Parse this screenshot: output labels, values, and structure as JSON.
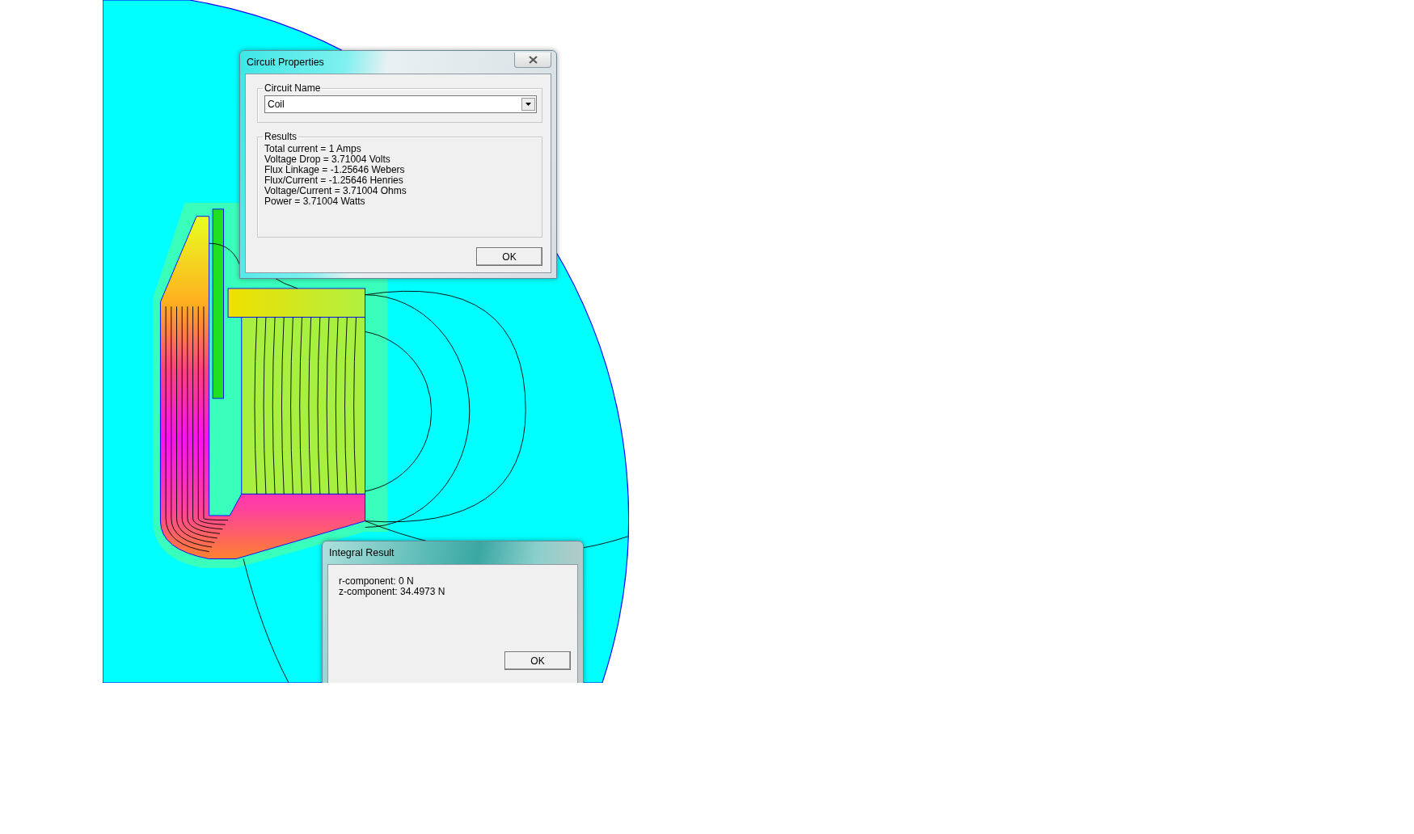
{
  "circuit_dialog": {
    "title": "Circuit Properties",
    "name_group": "Circuit Name",
    "circuit_name": "Coil",
    "results_group": "Results",
    "results": [
      "Total current = 1 Amps",
      "Voltage Drop = 3.71004 Volts",
      "Flux Linkage = -1.25646 Webers",
      "Flux/Current = -1.25646 Henries",
      "Voltage/Current = 3.71004 Ohms",
      "Power = 3.71004 Watts"
    ],
    "ok": "OK"
  },
  "integral_dialog": {
    "title": "Integral Result",
    "lines": [
      "r-component: 0 N",
      "z-component: 34.4973 N"
    ],
    "ok": "OK"
  }
}
